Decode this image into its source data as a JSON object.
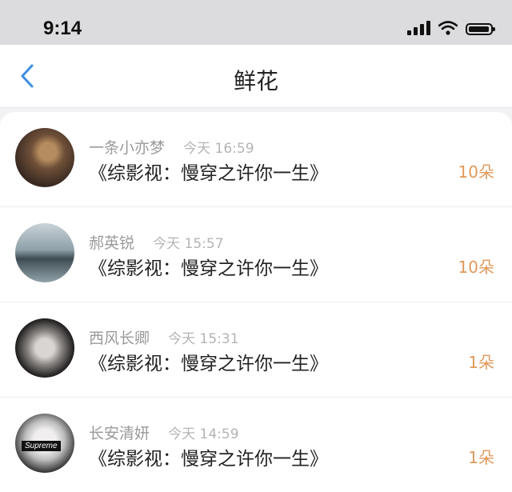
{
  "status_bar": {
    "time": "9:14"
  },
  "nav": {
    "title": "鲜花"
  },
  "gifts": [
    {
      "username": "一条小亦梦",
      "time": "今天 16:59",
      "book": "《综影视：慢穿之许你一生》",
      "count": "10朵"
    },
    {
      "username": "郝英锐",
      "time": "今天 15:57",
      "book": "《综影视：慢穿之许你一生》",
      "count": "10朵"
    },
    {
      "username": "西风长卿",
      "time": "今天 15:31",
      "book": "《综影视：慢穿之许你一生》",
      "count": "1朵"
    },
    {
      "username": "长安清妍",
      "time": "今天 14:59",
      "book": "《综影视：慢穿之许你一生》",
      "count": "1朵",
      "avatar_text": "Supreme"
    }
  ],
  "colors": {
    "accent": "#e0995a",
    "back_arrow": "#3d8fe0"
  }
}
